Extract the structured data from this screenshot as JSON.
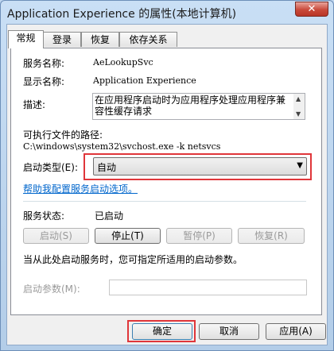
{
  "window": {
    "title": "Application Experience 的属性(本地计算机)",
    "close_label": "✕"
  },
  "tabs": [
    "常规",
    "登录",
    "恢复",
    "依存关系"
  ],
  "fields": {
    "service_name_label": "服务名称:",
    "service_name_value": "AeLookupSvc",
    "display_name_label": "显示名称:",
    "display_name_value": "Application Experience",
    "description_label": "描述:",
    "description_value": "在应用程序启动时为应用程序处理应用程序兼容性缓存请求",
    "exe_path_label": "可执行文件的路径:",
    "exe_path_value": "C:\\windows\\system32\\svchost.exe -k netsvcs",
    "startup_type_label": "启动类型(E):",
    "startup_type_value": "自动",
    "help_link": "帮助我配置服务启动选项。",
    "service_status_label": "服务状态:",
    "service_status_value": "已启动"
  },
  "service_buttons": {
    "start": "启动(S)",
    "stop": "停止(T)",
    "pause": "暂停(P)",
    "resume": "恢复(R)"
  },
  "hint_text": "当从此处启动服务时，您可指定所适用的启动参数。",
  "start_params_label": "启动参数(M):",
  "start_params_value": "",
  "dialog_buttons": {
    "ok": "确定",
    "cancel": "取消",
    "apply": "应用(A)"
  },
  "colors": {
    "highlight_box": "#e0363a",
    "link": "#0066cc"
  }
}
